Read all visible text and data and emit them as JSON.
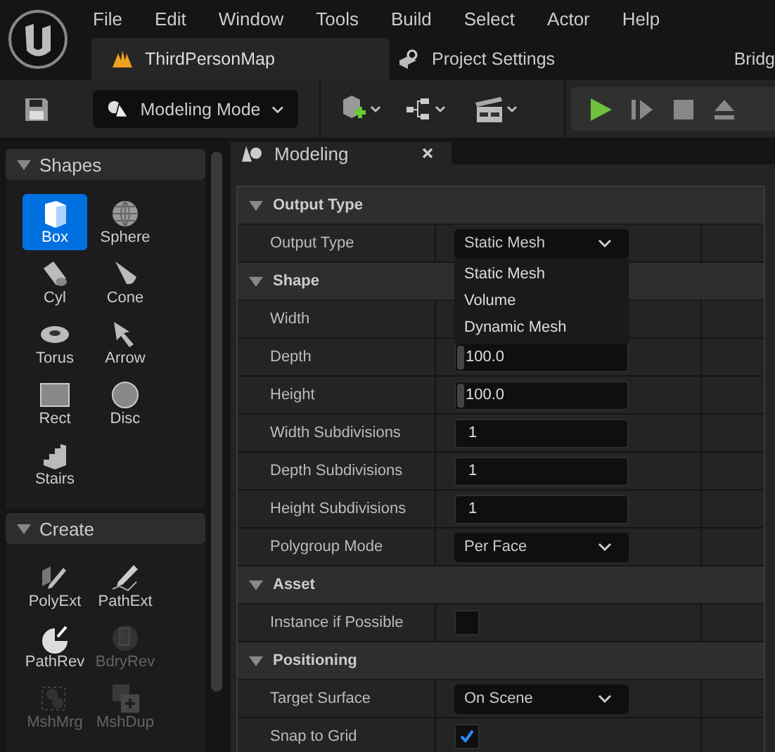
{
  "menu": [
    "File",
    "Edit",
    "Window",
    "Tools",
    "Build",
    "Select",
    "Actor",
    "Help"
  ],
  "tabs": [
    {
      "label": "ThirdPersonMap",
      "selected": true
    },
    {
      "label": "Project Settings",
      "selected": false
    },
    {
      "label": "Bridg",
      "selected": false
    }
  ],
  "toolbar": {
    "mode": "Modeling Mode"
  },
  "palette": [
    {
      "title": "Shapes",
      "expanded": true,
      "items": [
        {
          "label": "Box",
          "selected": true,
          "disabled": false
        },
        {
          "label": "Sphere",
          "selected": false,
          "disabled": false
        },
        {
          "label": "Cyl",
          "selected": false,
          "disabled": false
        },
        {
          "label": "Cone",
          "selected": false,
          "disabled": false
        },
        {
          "label": "Torus",
          "selected": false,
          "disabled": false
        },
        {
          "label": "Arrow",
          "selected": false,
          "disabled": false
        },
        {
          "label": "Rect",
          "selected": false,
          "disabled": false
        },
        {
          "label": "Disc",
          "selected": false,
          "disabled": false
        },
        {
          "label": "Stairs",
          "selected": false,
          "disabled": false
        }
      ]
    },
    {
      "title": "Create",
      "expanded": true,
      "items": [
        {
          "label": "PolyExt",
          "selected": false,
          "disabled": false
        },
        {
          "label": "PathExt",
          "selected": false,
          "disabled": false
        },
        {
          "label": "PathRev",
          "selected": false,
          "disabled": false
        },
        {
          "label": "BdryRev",
          "selected": false,
          "disabled": true
        },
        {
          "label": "MshMrg",
          "selected": false,
          "disabled": true
        },
        {
          "label": "MshDup",
          "selected": false,
          "disabled": true
        }
      ]
    }
  ],
  "panel": {
    "tab": "Modeling",
    "sections": [
      {
        "title": "Output Type",
        "expanded": true,
        "rows": [
          {
            "name": "Output Type",
            "kind": "dropdown",
            "value": "Static Mesh",
            "open": true,
            "options": [
              "Static Mesh",
              "Volume",
              "Dynamic Mesh"
            ]
          }
        ]
      },
      {
        "title": "Shape",
        "expanded": true,
        "rows": [
          {
            "name": "Width",
            "kind": "hidden"
          },
          {
            "name": "Depth",
            "kind": "number",
            "value": "100.0"
          },
          {
            "name": "Height",
            "kind": "number",
            "value": "100.0"
          },
          {
            "name": "Width Subdivisions",
            "kind": "int",
            "value": "1"
          },
          {
            "name": "Depth Subdivisions",
            "kind": "int",
            "value": "1"
          },
          {
            "name": "Height Subdivisions",
            "kind": "int",
            "value": "1"
          },
          {
            "name": "Polygroup Mode",
            "kind": "dropdown",
            "value": "Per Face",
            "open": false
          }
        ]
      },
      {
        "title": "Asset",
        "expanded": true,
        "rows": [
          {
            "name": "Instance if Possible",
            "kind": "checkbox",
            "checked": false
          }
        ]
      },
      {
        "title": "Positioning",
        "expanded": true,
        "rows": [
          {
            "name": "Target Surface",
            "kind": "dropdown",
            "value": "On Scene",
            "open": false
          },
          {
            "name": "Snap to Grid",
            "kind": "checkbox",
            "checked": true
          }
        ]
      }
    ]
  }
}
